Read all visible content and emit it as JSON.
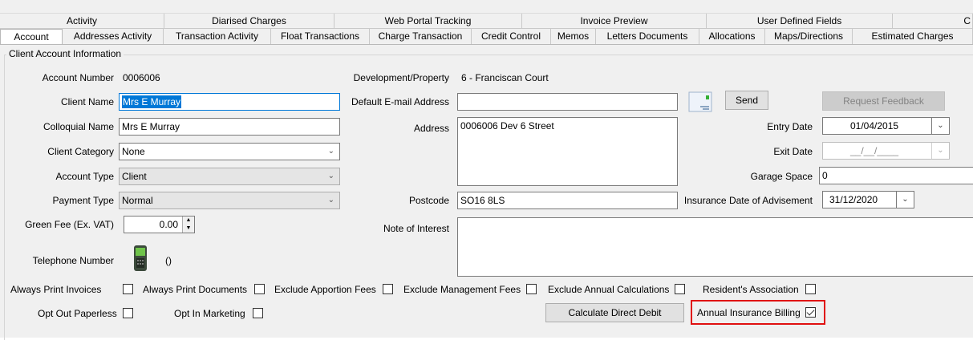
{
  "tabs_row1": [
    "Activity",
    "Diarised Charges",
    "Web Portal Tracking",
    "Invoice Preview",
    "User Defined Fields",
    "C"
  ],
  "tabs_row2": [
    "Account",
    "Addresses Activity",
    "Transaction Activity",
    "Float Transactions",
    "Charge Transaction",
    "Credit Control",
    "Memos",
    "Letters Documents",
    "Allocations",
    "Maps/Directions",
    "Estimated Charges"
  ],
  "group_title": "Client Account Information",
  "left": {
    "account_number_label": "Account Number",
    "account_number": "0006006",
    "client_name_label": "Client Name",
    "client_name": "Mrs E Murray",
    "colloquial_name_label": "Colloquial Name",
    "colloquial_name": "Mrs E Murray",
    "client_category_label": "Client Category",
    "client_category": "None",
    "account_type_label": "Account Type",
    "account_type": "Client",
    "payment_type_label": "Payment Type",
    "payment_type": "Normal",
    "green_fee_label": "Green Fee (Ex. VAT)",
    "green_fee": "0.00",
    "telephone_label": "Telephone Number",
    "telephone": "()"
  },
  "middle": {
    "development_label": "Development/Property",
    "development": "6 - Franciscan Court",
    "email_label": "Default E-mail Address",
    "email": "",
    "send_label": "Send",
    "address_label": "Address",
    "address": "0006006 Dev 6 Street",
    "postcode_label": "Postcode",
    "postcode": "SO16 8LS",
    "note_label": "Note of Interest",
    "note": ""
  },
  "right": {
    "request_feedback_label": "Request Feedback",
    "entry_date_label": "Entry Date",
    "entry_date": "01/04/2015",
    "exit_date_label": "Exit Date",
    "exit_date": "__/__/____",
    "garage_label": "Garage Space",
    "garage": "0",
    "insurance_label": "Insurance Date of Advisement",
    "insurance_date": "31/12/2020"
  },
  "checkboxes": [
    {
      "label": "Always Print Invoices",
      "checked": false
    },
    {
      "label": "Always Print Documents",
      "checked": false
    },
    {
      "label": "Exclude Apportion Fees",
      "checked": false
    },
    {
      "label": "Exclude Management Fees",
      "checked": false
    },
    {
      "label": "Exclude Annual Calculations",
      "checked": false
    },
    {
      "label": "Resident's Association",
      "checked": false
    },
    {
      "label": "Opt Out Paperless",
      "checked": false
    },
    {
      "label": "Opt In Marketing",
      "checked": false
    },
    {
      "label": "Annual Insurance Billing",
      "checked": true
    }
  ],
  "calculate_label": "Calculate Direct Debit",
  "colors": {
    "accent": "#0078d7",
    "highlight": "#e01010",
    "panel": "#f0f0f0"
  }
}
